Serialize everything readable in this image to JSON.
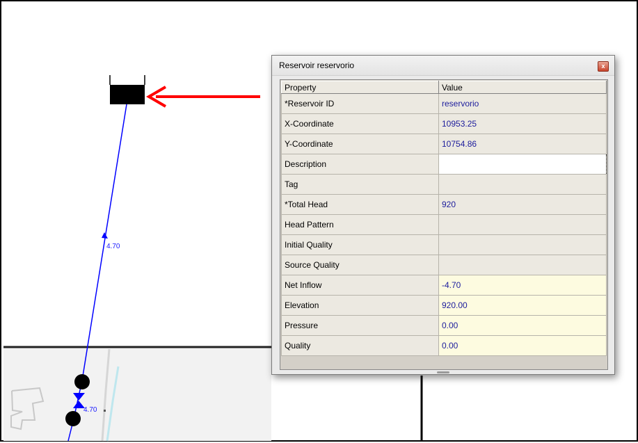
{
  "window": {
    "title": "Reservoir reservorio",
    "close_glyph": "x"
  },
  "grid": {
    "headers": {
      "property": "Property",
      "value": "Value"
    },
    "rows": [
      {
        "property": "*Reservoir ID",
        "value": "reservorio",
        "readonly": false
      },
      {
        "property": "X-Coordinate",
        "value": "10953.25",
        "readonly": false
      },
      {
        "property": "Y-Coordinate",
        "value": "10754.86",
        "readonly": false
      },
      {
        "property": "Description",
        "value": "",
        "readonly": false,
        "editing": true
      },
      {
        "property": "Tag",
        "value": "",
        "readonly": false
      },
      {
        "property": "*Total Head",
        "value": "920",
        "readonly": false
      },
      {
        "property": "Head Pattern",
        "value": "",
        "readonly": false
      },
      {
        "property": "Initial Quality",
        "value": "",
        "readonly": false
      },
      {
        "property": "Source Quality",
        "value": "",
        "readonly": false
      },
      {
        "property": "Net Inflow",
        "value": "-4.70",
        "readonly": true
      },
      {
        "property": "Elevation",
        "value": "920.00",
        "readonly": true
      },
      {
        "property": "Pressure",
        "value": "0.00",
        "readonly": true
      },
      {
        "property": "Quality",
        "value": "0.00",
        "readonly": true
      }
    ]
  },
  "map": {
    "pipe_flow_label": "4.70",
    "pipe_flow_label_lower": "4.70"
  },
  "colors": {
    "pipe": "#0000ff",
    "arrow": "#ff0000",
    "readonly_cell": "#fdfbe0"
  }
}
